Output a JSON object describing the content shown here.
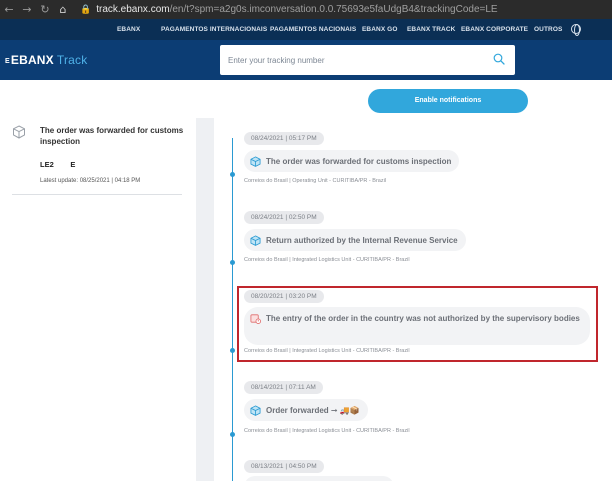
{
  "browser": {
    "back": "←",
    "forward": "→",
    "reload": "↻",
    "home": "⌂",
    "lock": "🔒",
    "url_domain": "track.ebanx.com",
    "url_rest": "/en/t?spm=a2g0s.imconversation.0.0.75693e5faUdgB4&trackingCode=LE"
  },
  "topnav": {
    "items": [
      "EBANX",
      "PAGAMENTOS INTERNACIONAIS",
      "PAGAMENTOS NACIONAIS",
      "EBANX GO",
      "EBANX TRACK",
      "EBANX CORPORATE",
      "OUTROS"
    ]
  },
  "header": {
    "logo_mark": "E",
    "logo_text": "EBANX",
    "logo_sub": "Track",
    "search_placeholder": "Enter your tracking number"
  },
  "notifications": {
    "label": "Enable notifications"
  },
  "sidebar": {
    "title": "The order was forwarded for customs inspection",
    "code": "LE2        E",
    "last_update": "Latest update: 08/25/2021 | 04:18 PM"
  },
  "events": [
    {
      "date": "08/24/2021 | 05:17 PM",
      "text": "The order was forwarded for customs inspection",
      "meta": "Correios do Brasil | Operating Unit - CURITIBA/PR - Brazil",
      "icon": "package-icon"
    },
    {
      "date": "08/24/2021 | 02:50 PM",
      "text": "Return authorized by the Internal Revenue Service",
      "meta": "Correios do Brasil | Integrated Logistics Unit - CURITIBA/PR - Brazil",
      "icon": "package-icon"
    },
    {
      "date": "08/20/2021 | 03:20 PM",
      "text": "The entry of the order in the country was not authorized by the supervisory bodies",
      "meta": "Correios do Brasil | Integrated Logistics Unit - CURITIBA/PR - Brazil",
      "icon": "package-alert-icon"
    },
    {
      "date": "08/14/2021 | 07:11 AM",
      "text": "Order forwarded ➞ 🚚📦",
      "meta": "Correios do Brasil | Integrated Logistics Unit - CURITIBA/PR - Brazil",
      "icon": "package-icon"
    },
    {
      "date": "08/13/2021 | 04:50 PM",
      "text": "",
      "meta": "",
      "icon": ""
    }
  ],
  "colors": {
    "topnav_bg": "#0b2f55",
    "header_bg": "#0c3d74",
    "accent": "#31a7dc",
    "timeline": "#2a9ad2",
    "highlight_border": "#c0262d",
    "alert_icon": "#e06a6a"
  }
}
